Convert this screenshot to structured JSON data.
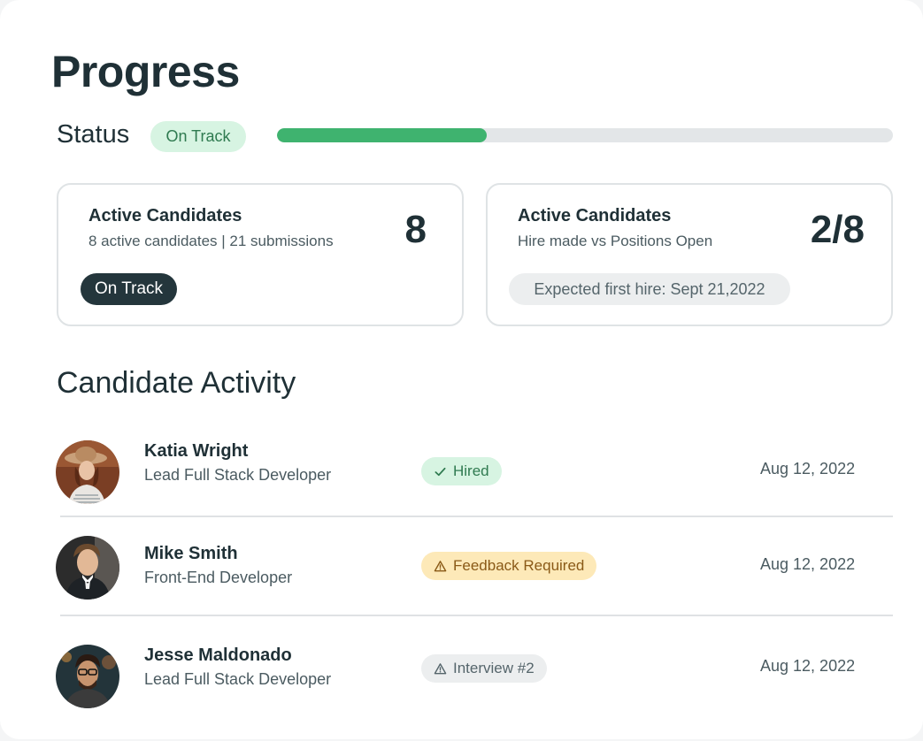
{
  "page_title": "Progress",
  "status": {
    "label": "Status",
    "pill": "On Track",
    "progress": 0.34,
    "progress_color": "#3fb36f"
  },
  "stats": [
    {
      "title": "Active Candidates",
      "subtitle": "8 active candidates | 21 submissions",
      "value": "8",
      "pill": "On Track"
    },
    {
      "title": "Active Candidates",
      "subtitle": "Hire made vs Positions Open",
      "value": "2/8",
      "pill": "Expected first hire: Sept 21,2022"
    }
  ],
  "activity": {
    "title": "Candidate Activity",
    "candidates": [
      {
        "name": "Katia Wright",
        "role": "Lead Full Stack Developer",
        "status": "Hired",
        "status_icon": "check-icon",
        "status_color": "#2f7a50",
        "date": "Aug 12, 2022"
      },
      {
        "name": "Mike Smith",
        "role": "Front-End Developer",
        "status": "Feedback Required",
        "status_icon": "warning-icon",
        "status_color": "#8a5a17",
        "date": "Aug 12, 2022"
      },
      {
        "name": "Jesse Maldonado",
        "role": "Lead Full Stack Developer",
        "status": "Interview #2",
        "status_icon": "warning-icon",
        "status_color": "#55656b",
        "date": "Aug 12, 2022"
      }
    ]
  }
}
